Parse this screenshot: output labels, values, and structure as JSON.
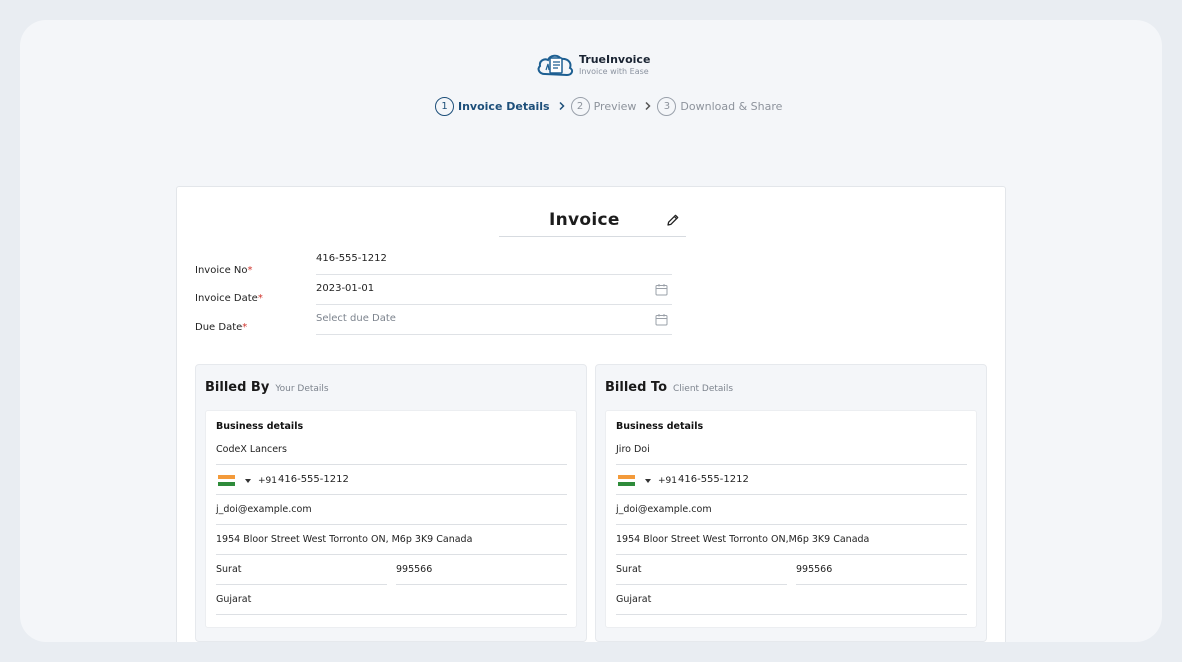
{
  "brand": {
    "name": "TrueInvoice",
    "tagline": "Invoice with Ease",
    "accent": "#1d4f7a"
  },
  "stepper": {
    "steps": [
      {
        "num": "1",
        "label": "Invoice Details",
        "active": true
      },
      {
        "num": "2",
        "label": "Preview",
        "active": false
      },
      {
        "num": "3",
        "label": "Download & Share",
        "active": false
      }
    ],
    "separator_icon": "chevron-right-icon"
  },
  "invoice": {
    "title": "Invoice",
    "edit_icon": "pencil-icon",
    "fields": {
      "invoice_no": {
        "label": "Invoice No",
        "required": "*",
        "value": "416-555-1212"
      },
      "invoice_date": {
        "label": "Invoice Date",
        "required": "*",
        "value": "2023-01-01",
        "icon": "calendar-icon"
      },
      "due_date": {
        "label": "Due Date",
        "required": "*",
        "placeholder": "Select due Date",
        "icon": "calendar-icon"
      }
    }
  },
  "billed_by": {
    "title": "Billed By",
    "subtitle": "Your Details",
    "section_title": "Business details",
    "name": "CodeX Lancers",
    "country_code": "+91",
    "phone": "416-555-1212",
    "email": "j_doi@example.com",
    "address": "1954 Bloor Street West Torronto ON, M6p 3K9 Canada",
    "city": "Surat",
    "postal": "995566",
    "state": "Gujarat"
  },
  "billed_to": {
    "title": "Billed To",
    "subtitle": "Client Details",
    "section_title": "Business details",
    "name": "Jiro Doi",
    "country_code": "+91",
    "phone": "416-555-1212",
    "email": "j_doi@example.com",
    "address": "1954 Bloor Street West Torronto ON,M6p 3K9 Canada",
    "city": "Surat",
    "postal": "995566",
    "state": "Gujarat"
  },
  "flag_colors": [
    "#f39a3a",
    "#ffffff",
    "#2e8b3a"
  ]
}
